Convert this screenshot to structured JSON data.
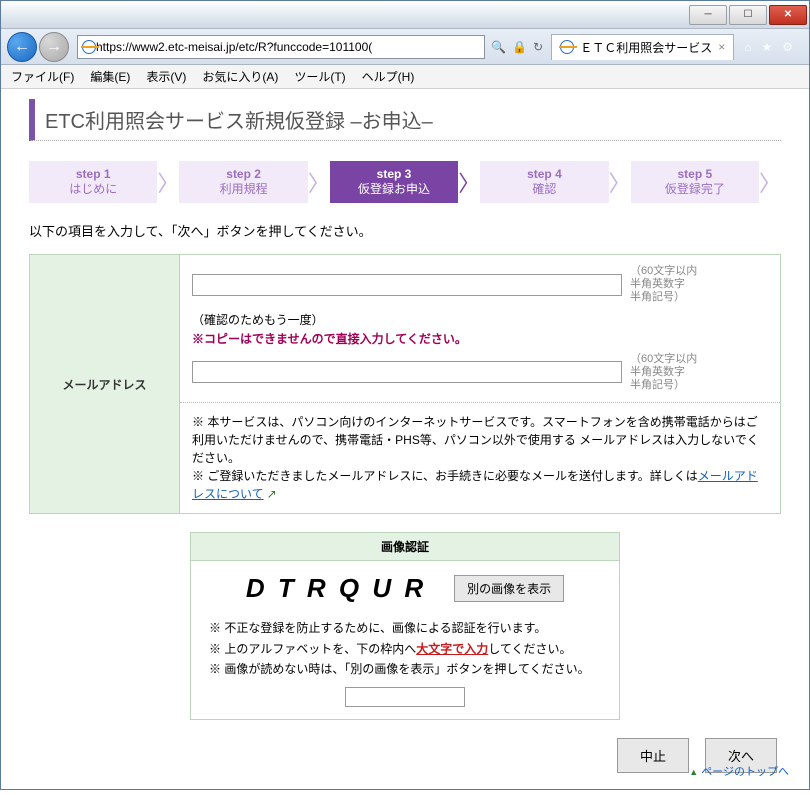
{
  "window": {
    "minLabel": "─",
    "maxLabel": "☐",
    "closeLabel": "✕"
  },
  "address": {
    "url": "https://www2.etc-meisai.jp/etc/R?funccode=101100(",
    "searchIcon": "🔍",
    "lockIcon": "🔒",
    "refreshIcon": "↻"
  },
  "tab": {
    "title": "ＥＴＣ利用照会サービス",
    "close": "×"
  },
  "cmdIcons": {
    "home": "⌂",
    "star": "★",
    "gear": "⚙"
  },
  "menu": {
    "file": "ファイル(F)",
    "edit": "編集(E)",
    "view": "表示(V)",
    "fav": "お気に入り(A)",
    "tool": "ツール(T)",
    "help": "ヘルプ(H)"
  },
  "pageTitle": "ETC利用照会サービス新規仮登録 –お申込–",
  "steps": [
    {
      "num": "step 1",
      "label": "はじめに"
    },
    {
      "num": "step 2",
      "label": "利用規程"
    },
    {
      "num": "step 3",
      "label": "仮登録お申込"
    },
    {
      "num": "step 4",
      "label": "確認"
    },
    {
      "num": "step 5",
      "label": "仮登録完了"
    }
  ],
  "instruction": "以下の項目を入力して、「次へ」ボタンを押してください。",
  "form": {
    "rowLabel": "メールアドレス",
    "hint1a": "（60文字以内",
    "hint1b": "半角英数字",
    "hint1c": "半角記号）",
    "confirmLabel": "（確認のためもう一度）",
    "warn": "※コピーはできませんので直接入力してください。",
    "note1": "※ 本サービスは、パソコン向けのインターネットサービスです。スマートフォンを含め携帯電話からはご利用いただけませんので、携帯電話・PHS等、パソコン以外で使用する メールアドレスは入力しないでください。",
    "note2_pre": "※ ご登録いただきましたメールアドレスに、お手続きに必要なメールを送付します。詳しくは",
    "note2_link": "メールアドレスについて",
    "note2_icon": "↗"
  },
  "captcha": {
    "heading": "画像認証",
    "code": "D T R Q U R",
    "refreshBtn": "別の画像を表示",
    "note1": "※ 不正な登録を防止するために、画像による認証を行います。",
    "note2_pre": "※ 上のアルファベットを、下の枠内へ",
    "note2_red": "大文字で入力",
    "note2_post": "してください。",
    "note3": "※ 画像が読めない時は、「別の画像を表示」ボタンを押してください。"
  },
  "buttons": {
    "cancel": "中止",
    "next": "次へ"
  },
  "pageTop": "ページのトップへ"
}
